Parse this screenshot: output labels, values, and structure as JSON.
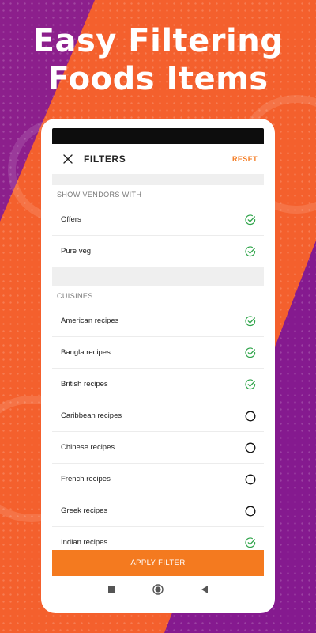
{
  "colors": {
    "brand_orange": "#f4602d",
    "accent_orange": "#f47a1f",
    "brand_purple": "#851a8f",
    "check_green": "#2fa44a"
  },
  "promo": {
    "line1": "Easy Filtering",
    "line2": "Foods Items"
  },
  "header": {
    "close_icon": "close-icon",
    "title": "FILTERS",
    "reset_label": "RESET"
  },
  "vendors": {
    "heading": "SHOW VENDORS WITH",
    "items": [
      {
        "label": "Offers",
        "checked": true
      },
      {
        "label": "Pure veg",
        "checked": true
      }
    ]
  },
  "cuisines": {
    "heading": "CUISINES",
    "items": [
      {
        "label": "American recipes",
        "checked": true
      },
      {
        "label": "Bangla recipes",
        "checked": true
      },
      {
        "label": "British recipes",
        "checked": true
      },
      {
        "label": "Caribbean recipes",
        "checked": false
      },
      {
        "label": "Chinese recipes",
        "checked": false
      },
      {
        "label": "French recipes",
        "checked": false
      },
      {
        "label": "Greek recipes",
        "checked": false
      },
      {
        "label": "Indian recipes",
        "checked": true
      }
    ]
  },
  "footer": {
    "apply_label": "APPLY FILTER"
  },
  "navbar": {
    "items": [
      "recents-icon",
      "home-icon",
      "back-icon"
    ]
  }
}
